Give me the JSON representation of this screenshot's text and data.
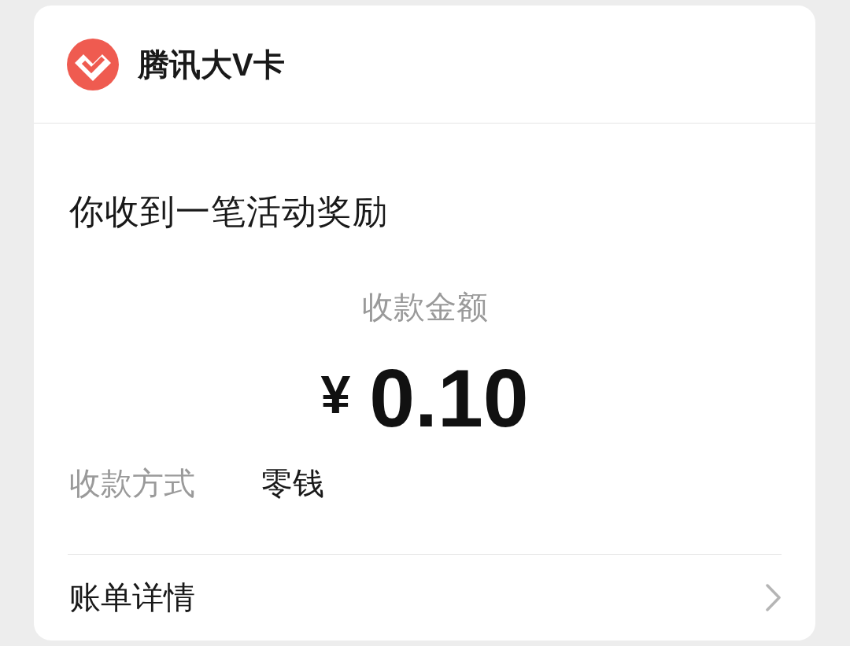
{
  "header": {
    "title": "腾讯大V卡"
  },
  "notice": {
    "title": "你收到一笔活动奖励"
  },
  "amount": {
    "label": "收款金额",
    "currency": "¥",
    "value": "0.10"
  },
  "details": [
    {
      "label": "收款方式",
      "value": "零钱"
    }
  ],
  "link": {
    "label": "账单详情"
  }
}
